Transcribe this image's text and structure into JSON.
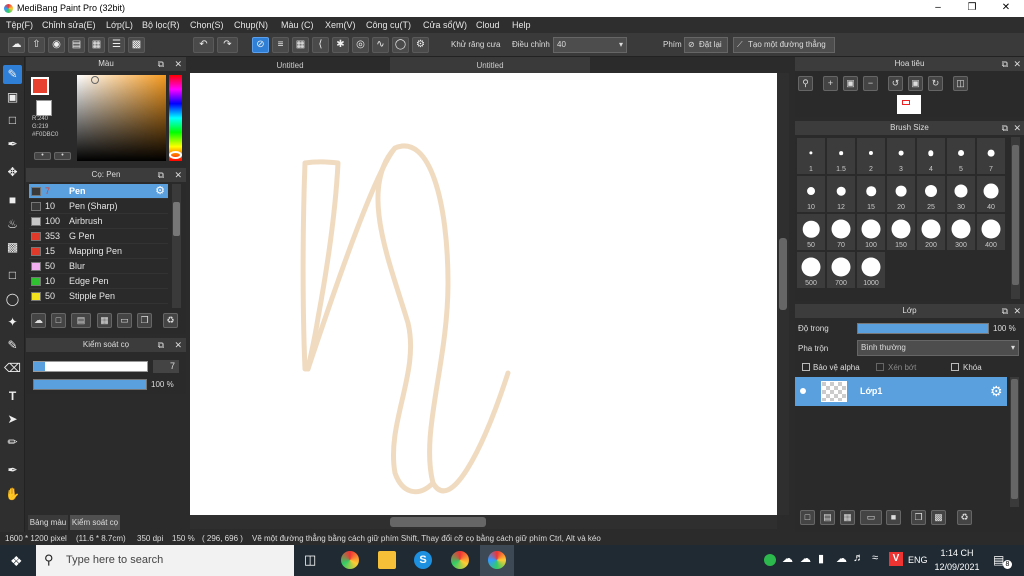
{
  "app": {
    "title": "MediBang Paint Pro (32bit)"
  },
  "menu": [
    "Tệp(F)",
    "Chỉnh sửa(E)",
    "Lớp(L)",
    "Bộ lọc(R)",
    "Chọn(S)",
    "Chụp(N)",
    "Màu (C)",
    "Xem(V)",
    "Công cụ(T)",
    "Cửa sổ(W)",
    "Cloud",
    "Help"
  ],
  "toolbar": {
    "antialias_label": "Khử răng cưa",
    "adjust_label": "Điều chỉnh",
    "adjust_value": "40",
    "key_label": "Phím",
    "reset_label": "Đặt lại",
    "straight_label": "Tạo một đường thẳng"
  },
  "color_panel": {
    "title": "Màu",
    "r": "R:240",
    "g": "G:219",
    "hex": "#F0DBC0",
    "fg_color": "#e8412f",
    "hue_cursor_pct": 95
  },
  "brush_panel": {
    "title": "Cọ: Pen",
    "items": [
      {
        "num": "7",
        "name": "Pen",
        "swatch": "#3a3a3a",
        "selected": true
      },
      {
        "num": "10",
        "name": "Pen (Sharp)",
        "swatch": "#3a3a3a"
      },
      {
        "num": "100",
        "name": "Airbrush",
        "swatch": "#c8c8c8"
      },
      {
        "num": "353",
        "name": "G Pen",
        "swatch": "#e23a2a"
      },
      {
        "num": "15",
        "name": "Mapping Pen",
        "swatch": "#e23a2a"
      },
      {
        "num": "50",
        "name": "Blur",
        "swatch": "#f2b0f0"
      },
      {
        "num": "10",
        "name": "Edge Pen",
        "swatch": "#2fc12f"
      },
      {
        "num": "50",
        "name": "Stipple Pen",
        "swatch": "#f2e21e"
      }
    ]
  },
  "brush_control": {
    "title": "Kiểm soát cọ",
    "size_value": "7",
    "size_pct": 10,
    "opacity_value": "100 %",
    "opacity_pct": 100
  },
  "left_tabs": [
    "Bảng màu",
    "Kiểm soát cọ"
  ],
  "canvas_tabs": [
    "Untitled",
    "Untitled"
  ],
  "navigator": {
    "title": "Hoa tiêu"
  },
  "brush_size": {
    "title": "Brush Size",
    "sizes": [
      "1",
      "1.5",
      "2",
      "3",
      "4",
      "5",
      "7",
      "10",
      "12",
      "15",
      "20",
      "25",
      "30",
      "40",
      "50",
      "70",
      "100",
      "150",
      "200",
      "300",
      "400",
      "500",
      "700",
      "1000"
    ]
  },
  "layer_panel": {
    "title": "Lớp",
    "opacity_label": "Độ trong",
    "opacity_value": "100 %",
    "opacity_pct": 100,
    "blend_label": "Pha trộn",
    "blend_value": "Bình thường",
    "protect_alpha": "Bảo vệ alpha",
    "clip": "Xén bớt",
    "lock": "Khóa",
    "layer_name": "Lớp1"
  },
  "status": {
    "size": "1600 * 1200 pixel",
    "cm": "(11.6 * 8.7cm)",
    "dpi": "350 dpi",
    "zoom": "150 %",
    "coords": "( 296, 696 )",
    "hint": "Vẽ một đường thẳng bằng cách giữ phím Shift, Thay đổi cỡ cọ bằng cách giữ phím Ctrl, Alt và kéo"
  },
  "taskbar": {
    "search_placeholder": "Type here to search",
    "lang": "ENG",
    "time": "1:14 CH",
    "date": "12/09/2021",
    "notif_count": "8"
  },
  "colors": {
    "accent": "#2f7fd6",
    "stroke": "#F0DBC0",
    "selection": "#5aa0df"
  }
}
